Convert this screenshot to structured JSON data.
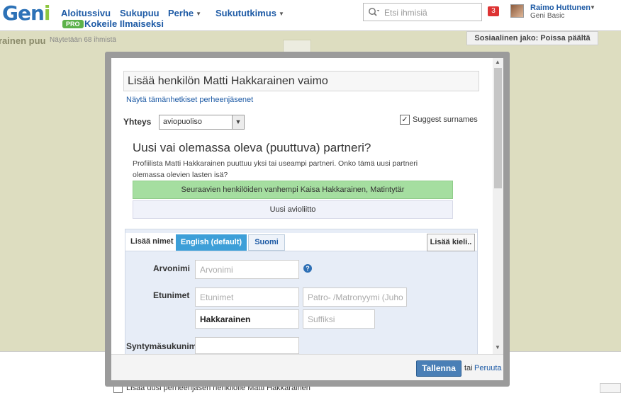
{
  "header": {
    "logo": "Geni",
    "nav": [
      {
        "label": "Aloitussivu"
      },
      {
        "label": "Sukupuu"
      },
      {
        "label": "Perhe"
      },
      {
        "label": "Sukututkimus"
      }
    ],
    "pro_badge": "PRO",
    "pro_link": "Kokeile Ilmaiseksi",
    "search_placeholder": "Etsi ihmisiä",
    "notification_count": "3",
    "user_name": "Raimo Huttunen",
    "user_plan": "Geni Basic"
  },
  "page": {
    "title": "rainen puu",
    "subtitle": "Näytetään 68 ihmistä",
    "share_button": "Sosiaalinen jako: Poissa päältä",
    "bottom_checkbox_label": "Lisää uusi perheenjäsen henkilölle Matti Hakkarainen"
  },
  "modal": {
    "title": "Lisää henkilön Matti Hakkarainen vaimo",
    "show_family_link": "Näytä tämänhetkiset perheenjäsenet",
    "relation_label": "Yhteys",
    "relation_value": "aviopuoliso",
    "suggest_surnames_label": "Suggest surnames",
    "suggest_surnames_checked": true,
    "partner_question": "Uusi vai olemassa oleva (puuttuva) partneri?",
    "partner_description": "Profiilista Matti Hakkarainen puuttuu yksi tai useampi partneri. Onko tämä uusi partneri olemassa olevien lasten isä?",
    "partner_option_existing": "Seuraavien henkilöiden vanhempi Kaisa Hakkarainen, Matintytär",
    "partner_option_new": "Uusi avioliitto",
    "names": {
      "label": "Lisää nimet",
      "tab_active": "English (default)",
      "tab_other": "Suomi",
      "add_language_button": "Lisää kieli.."
    },
    "fields": {
      "title_label": "Arvonimi",
      "title_placeholder": "Arvonimi",
      "first_label": "Etunimet",
      "first_placeholder": "Etunimet",
      "patronym_placeholder": "Patro- /Matronyymi (Juho",
      "last_value": "Hakkarainen",
      "suffix_placeholder": "Suffiksi",
      "birth_surname_label": "Syntymäsukunimi"
    },
    "save_button": "Tallenna",
    "or_text": "tai",
    "cancel_link": "Peruuta"
  }
}
